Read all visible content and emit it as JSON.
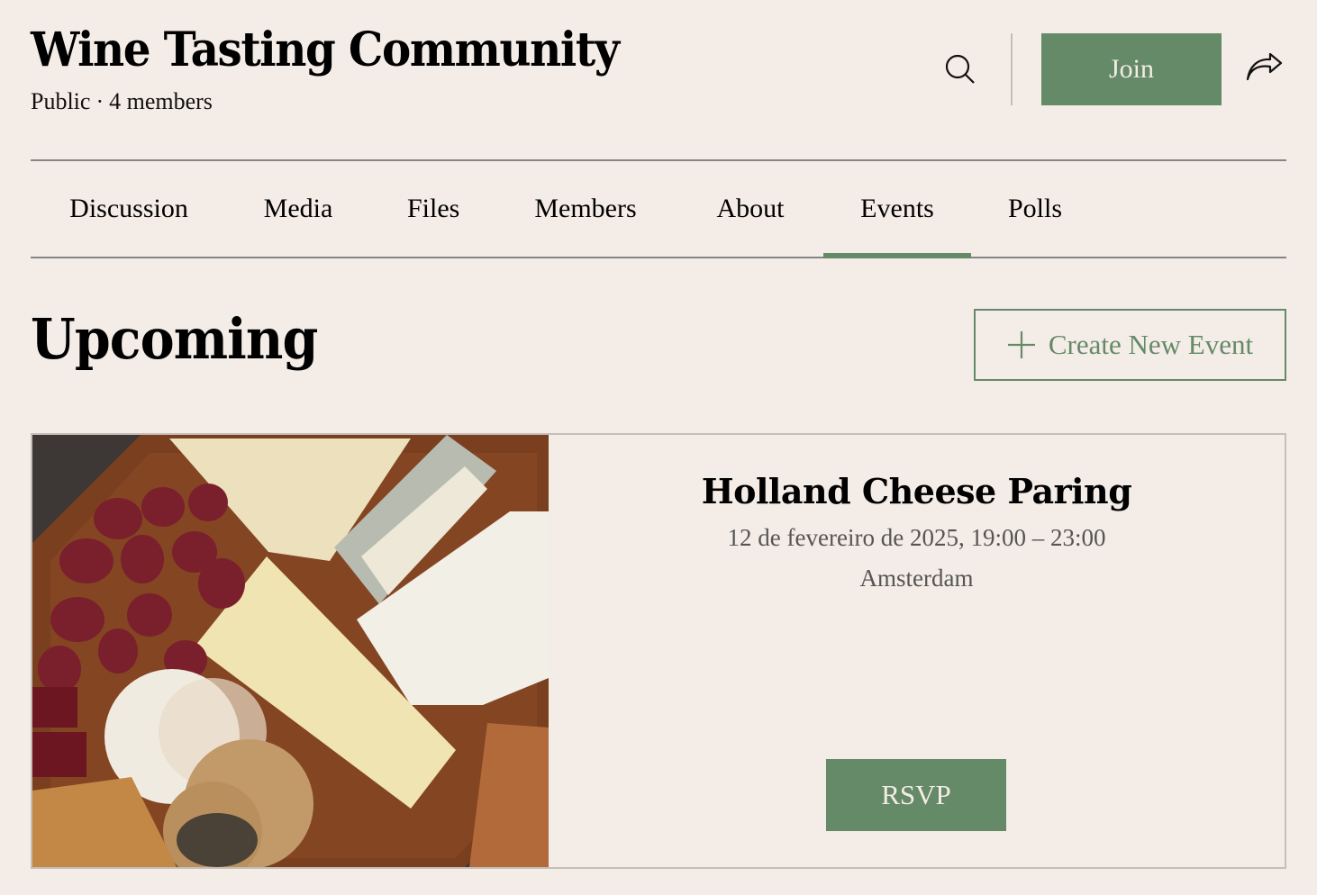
{
  "header": {
    "title": "Wine Tasting Community",
    "visibility": "Public",
    "separator": "·",
    "members": "4 members",
    "join_label": "Join",
    "search_icon": "search-icon",
    "share_icon": "share-icon"
  },
  "tabs": [
    {
      "label": "Discussion",
      "active": false
    },
    {
      "label": "Media",
      "active": false
    },
    {
      "label": "Files",
      "active": false
    },
    {
      "label": "Members",
      "active": false
    },
    {
      "label": "About",
      "active": false
    },
    {
      "label": "Events",
      "active": true
    },
    {
      "label": "Polls",
      "active": false
    }
  ],
  "events": {
    "section_title": "Upcoming",
    "create_label": "Create New Event",
    "create_icon": "plus-icon",
    "items": [
      {
        "title": "Holland Cheese Paring",
        "date": "12 de fevereiro de 2025, 19:00 – 23:00",
        "location": "Amsterdam",
        "image_alt": "Cheese board with grapes and crackers",
        "rsvp_label": "RSVP"
      }
    ]
  },
  "colors": {
    "background": "#f4ece6",
    "accent": "#658a68",
    "divider": "#858585",
    "card_border": "#c6beb8"
  }
}
